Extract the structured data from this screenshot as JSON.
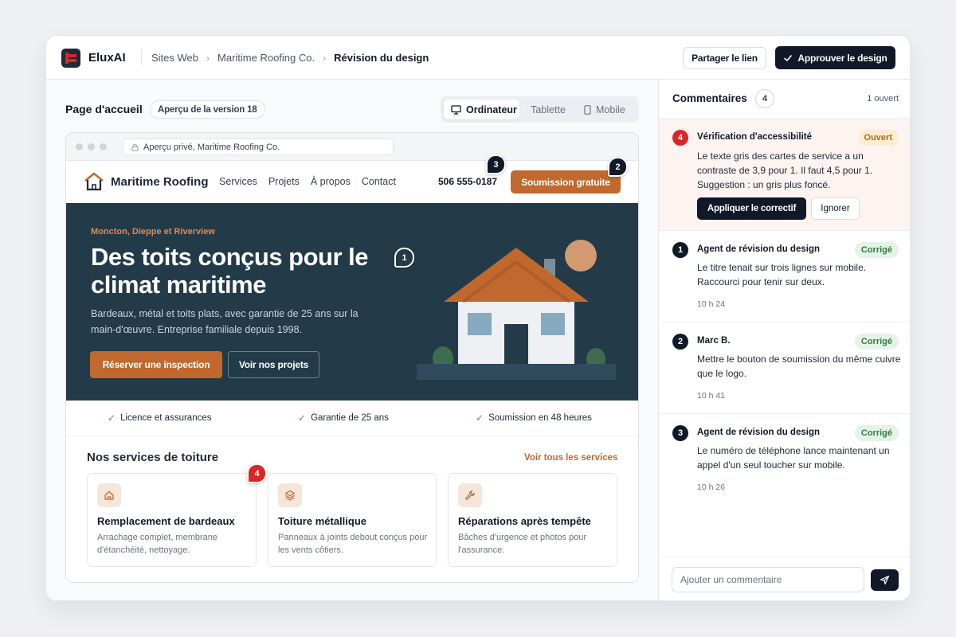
{
  "app": {
    "brand": "EluxAI"
  },
  "breadcrumb": {
    "items": [
      "Sites Web",
      "Maritime Roofing Co."
    ],
    "current": "Révision du design"
  },
  "header": {
    "share_label": "Partager le lien",
    "approve_label": "Approuver le design"
  },
  "preview": {
    "page_title": "Page d'accueil",
    "version_label": "Aperçu de la version 18",
    "devices": [
      "Ordinateur",
      "Tablette",
      "Mobile"
    ],
    "active_device": "Ordinateur",
    "url": "Aperçu privé, Maritime Roofing Co."
  },
  "site": {
    "brand": "Maritime Roofing",
    "nav": [
      "Services",
      "Projets",
      "À propos",
      "Contact"
    ],
    "phone": "506 555-0187",
    "cta": "Soumission gratuite",
    "hero": {
      "eyebrow": "Moncton, Dieppe et Riverview",
      "title": "Des toits conçus pour le climat maritime",
      "subtitle": "Bardeaux, métal et toits plats, avec garantie de 25 ans sur la main-d'œuvre. Entreprise familiale depuis 1998.",
      "primary_cta": "Réserver une inspection",
      "secondary_cta": "Voir nos projets"
    },
    "features": [
      "Licence et assurances",
      "Garantie de 25 ans",
      "Soumission en 48 heures"
    ],
    "services_title": "Nos services de toiture",
    "services_link": "Voir tous les services",
    "services": [
      {
        "icon": "home-icon",
        "title": "Remplacement de bardeaux",
        "desc": "Arrachage complet, membrane d'étanchéité, nettoyage."
      },
      {
        "icon": "layers-icon",
        "title": "Toiture métallique",
        "desc": "Panneaux à joints debout conçus pour les vents côtiers."
      },
      {
        "icon": "wrench-icon",
        "title": "Réparations après tempête",
        "desc": "Bâches d'urgence et photos pour l'assurance."
      }
    ]
  },
  "markers": [
    "1",
    "2",
    "3",
    "4"
  ],
  "comments_panel": {
    "title": "Commentaires",
    "count": "4",
    "open_count": "1 ouvert",
    "comments": [
      {
        "num": "4",
        "author": "Vérification d'accessibilité",
        "status": "Ouvert",
        "body": "Le texte gris des cartes de service a un contraste de 3,9 pour 1. Il faut 4,5 pour 1. Suggestion : un gris plus foncé.",
        "apply_label": "Appliquer le correctif",
        "ignore_label": "Ignorer"
      },
      {
        "num": "1",
        "author": "Agent de révision du design",
        "status": "Corrigé",
        "body": "Le titre tenait sur trois lignes sur mobile. Raccourci pour tenir sur deux.",
        "time": "10 h 24"
      },
      {
        "num": "2",
        "author": "Marc B.",
        "status": "Corrigé",
        "body": "Mettre le bouton de soumission du même cuivre que le logo.",
        "time": "10 h 41"
      },
      {
        "num": "3",
        "author": "Agent de révision du design",
        "status": "Corrigé",
        "body": "Le numéro de téléphone lance maintenant un appel d'un seul toucher sur mobile.",
        "time": "10 h 26"
      }
    ],
    "composer_placeholder": "Ajouter un commentaire"
  },
  "colors": {
    "accent": "#c0682d",
    "dark": "#111827",
    "hero_bg": "#233a49",
    "alert": "#dc2626"
  }
}
